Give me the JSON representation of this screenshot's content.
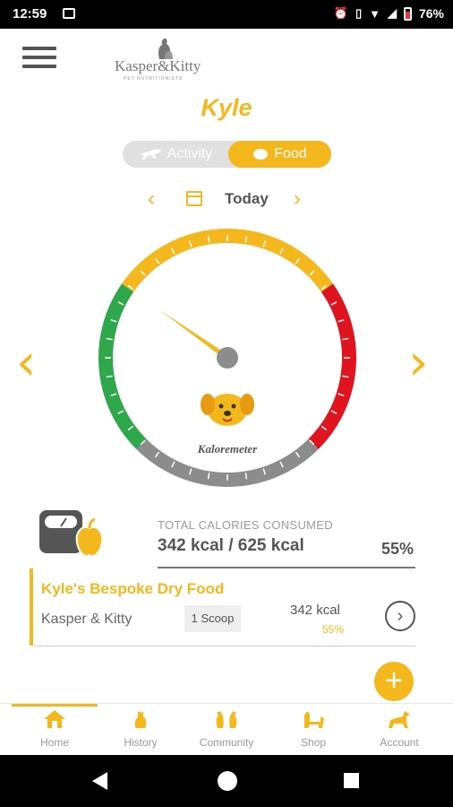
{
  "status_bar": {
    "time": "12:59",
    "battery": "76%"
  },
  "header": {
    "brand": "Kasper&Kitty",
    "tagline": "PET NUTRITIONISTS"
  },
  "pet": {
    "name": "Kyle"
  },
  "toggle": {
    "activity_label": "Activity",
    "food_label": "Food",
    "selected": "Food"
  },
  "date_nav": {
    "label": "Today"
  },
  "gauge": {
    "label": "Kaloremeter",
    "fraction_consumed": 0.55
  },
  "stats": {
    "caption": "TOTAL CALORIES CONSUMED",
    "value": "342 kcal / 625 kcal",
    "percent": "55%"
  },
  "food_item": {
    "name": "Kyle's Bespoke Dry Food",
    "brand": "Kasper & Kitty",
    "portion": "1 Scoop",
    "kcal": "342 kcal",
    "percent": "55%"
  },
  "tabs": [
    {
      "label": "Home",
      "icon": "home-icon"
    },
    {
      "label": "History",
      "icon": "history-icon"
    },
    {
      "label": "Community",
      "icon": "community-icon"
    },
    {
      "label": "Shop",
      "icon": "shop-icon"
    },
    {
      "label": "Account",
      "icon": "account-icon"
    }
  ],
  "colors": {
    "accent": "#f5b81c",
    "green": "#2ea84a",
    "red": "#e0141e",
    "grey": "#8c8c8c"
  }
}
